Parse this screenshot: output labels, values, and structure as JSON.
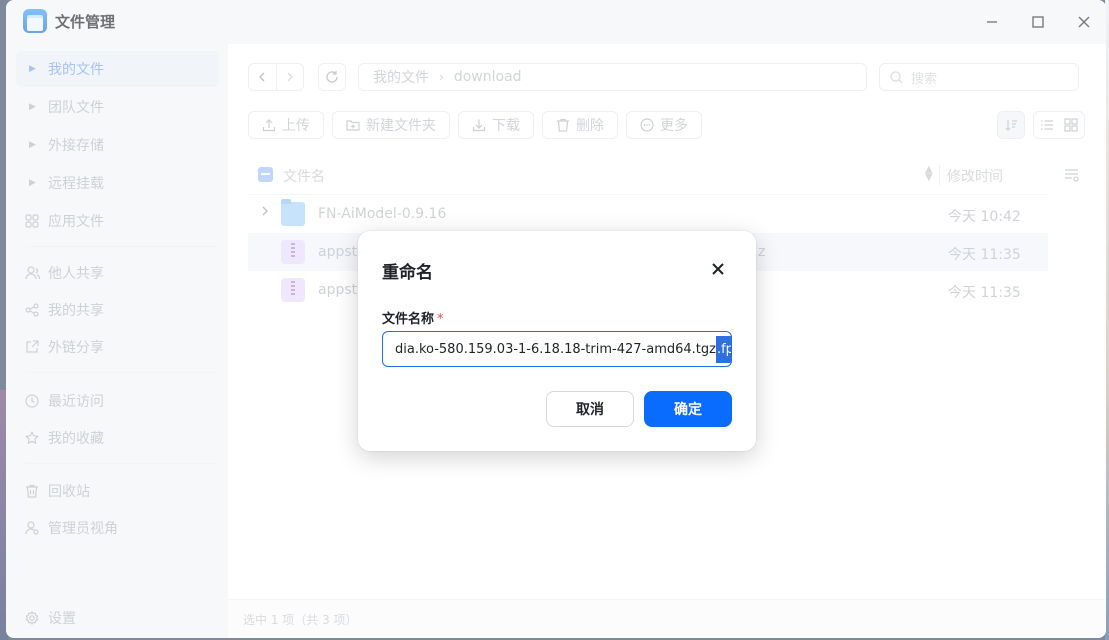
{
  "app": {
    "title": "文件管理"
  },
  "window_controls": [
    "minimize",
    "maximize",
    "close"
  ],
  "sidebar": {
    "items": [
      {
        "label": "我的文件",
        "icon": "caret-right-icon",
        "active": true
      },
      {
        "label": "团队文件",
        "icon": "caret-right-icon"
      },
      {
        "label": "外接存储",
        "icon": "caret-right-icon"
      },
      {
        "label": "远程挂载",
        "icon": "caret-right-icon"
      },
      {
        "label": "应用文件",
        "icon": "apps-grid-icon"
      },
      {
        "label": "他人共享",
        "icon": "users-icon"
      },
      {
        "label": "我的共享",
        "icon": "share-icon"
      },
      {
        "label": "外链分享",
        "icon": "external-link-icon"
      },
      {
        "label": "最近访问",
        "icon": "clock-icon"
      },
      {
        "label": "我的收藏",
        "icon": "star-icon"
      },
      {
        "label": "回收站",
        "icon": "trash-icon"
      },
      {
        "label": "管理员视角",
        "icon": "admin-user-icon"
      }
    ],
    "settings_label": "设置"
  },
  "breadcrumb": {
    "root": "我的文件",
    "current": "download"
  },
  "search": {
    "placeholder": "搜索"
  },
  "toolbar": {
    "upload": "上传",
    "new_folder": "新建文件夹",
    "download": "下载",
    "delete": "删除",
    "more": "更多"
  },
  "list": {
    "columns": {
      "name": "文件名",
      "modified": "修改时间"
    },
    "rows": [
      {
        "name": "FN-AiModel-0.9.16",
        "type": "folder",
        "modified": "今天 10:42"
      },
      {
        "name": "appsto",
        "name_tail": "z",
        "type": "archive",
        "modified": "今天 11:35",
        "selected": true
      },
      {
        "name": "appsto",
        "type": "archive",
        "modified": "今天 11:35"
      }
    ]
  },
  "status": {
    "text": "选中 1 项（共 3 项）"
  },
  "dialog": {
    "title": "重命名",
    "field_label": "文件名称",
    "required_mark": "*",
    "input_value_prefix": "dia.ko-580.159.03-1-6.18.18-trim-427-amd64.tgz",
    "input_value_selected": ".fpk",
    "cancel": "取消",
    "confirm": "确定"
  },
  "colors": {
    "accent": "#0a6cff",
    "required": "#e8484b",
    "selection": "#2f6fe0"
  }
}
